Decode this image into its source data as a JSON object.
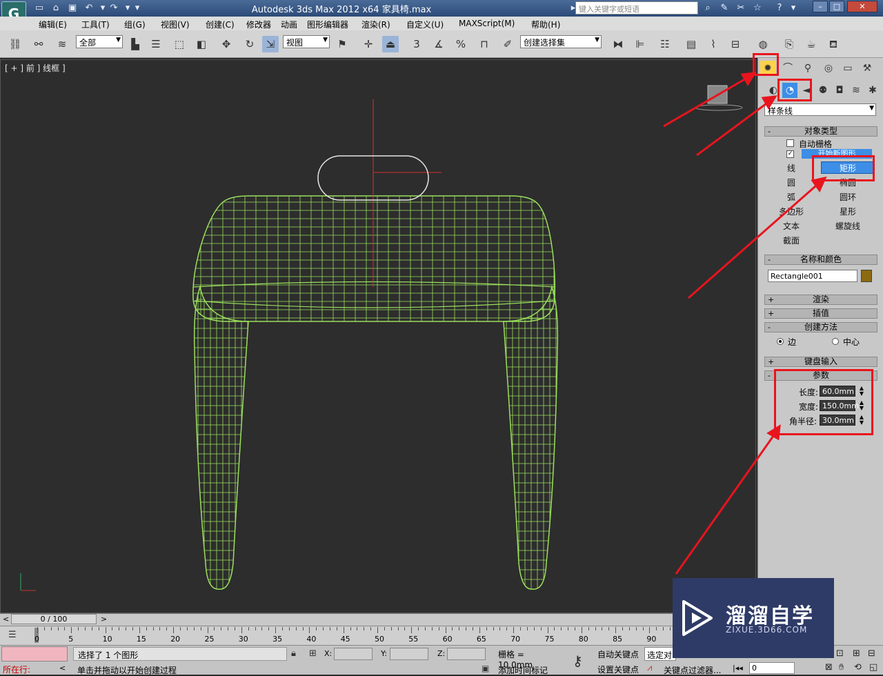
{
  "window": {
    "title": "Autodesk 3ds Max  2012 x64      家具椅.max",
    "search_placeholder": "键入关键字或短语",
    "help_icon": "?",
    "logo_letter": "G"
  },
  "menubar": {
    "items": [
      "编辑(E)",
      "工具(T)",
      "组(G)",
      "视图(V)",
      "创建(C)",
      "修改器",
      "动画",
      "图形编辑器",
      "渲染(R)",
      "自定义(U)",
      "MAXScript(M)",
      "帮助(H)"
    ]
  },
  "toolbar": {
    "selection_filter": "全部",
    "reference_coord": "视图",
    "named_selection": "创建选择集",
    "snap_3": "3",
    "percent": "%"
  },
  "viewport": {
    "label": "[ + ] 前 ] 线框 ]",
    "colors": {
      "wire": "#9be05c",
      "axis": "#d83030",
      "shape": "#e6e6e6"
    }
  },
  "command_panel": {
    "category": "样条线",
    "rollout_object_type": "对象类型",
    "autogrid_label": "自动栅格",
    "start_new_shape": "开始新图形",
    "buttons": [
      [
        "线",
        "矩形"
      ],
      [
        "圆",
        "椭圆"
      ],
      [
        "弧",
        "圆环"
      ],
      [
        "多边形",
        "星形"
      ],
      [
        "文本",
        "螺旋线"
      ],
      [
        "截面",
        ""
      ]
    ],
    "active_button": "矩形",
    "rollout_name_color": "名称和颜色",
    "object_name": "Rectangle001",
    "object_color": "#8a6a12",
    "rollout_render": "渲染",
    "rollout_interp": "插值",
    "rollout_creation": "创建方法",
    "creation_edge": "边",
    "creation_center": "中心",
    "rollout_keyboard": "键盘输入",
    "rollout_params": "参数",
    "params": [
      {
        "label": "长度:",
        "value": "60.0mm"
      },
      {
        "label": "宽度:",
        "value": "150.0mm"
      },
      {
        "label": "角半径:",
        "value": "30.0mm"
      }
    ]
  },
  "timeline": {
    "frame": "0 / 100",
    "ticks": [
      "0",
      "5",
      "10",
      "15",
      "20",
      "25",
      "30",
      "35",
      "40",
      "45",
      "50",
      "55",
      "60",
      "65",
      "70",
      "75",
      "80",
      "85",
      "90"
    ]
  },
  "status": {
    "where": "所在行:",
    "selected": "选择了 1 个图形",
    "prompt": "单击并拖动以开始创建过程",
    "x_label": "X:",
    "y_label": "Y:",
    "z_label": "Z:",
    "grid": "栅格 = 10.0mm",
    "add_time_tag": "添加时间标记",
    "auto_key": "自动关键点",
    "set_key": "设置关键点",
    "selected_obj": "选定对",
    "key_filter": "关键点过滤器...",
    "frame_field": "0"
  },
  "watermark": {
    "text": "溜溜自学",
    "sub": "ZIXUE.3D66.COM"
  }
}
